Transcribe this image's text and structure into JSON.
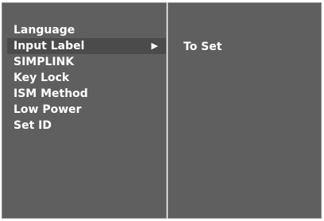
{
  "menu": {
    "items": [
      {
        "label": "Language"
      },
      {
        "label": "Input Label"
      },
      {
        "label": "SIMPLINK"
      },
      {
        "label": "Key Lock"
      },
      {
        "label": "ISM Method"
      },
      {
        "label": "Low Power"
      },
      {
        "label": "Set ID"
      }
    ],
    "selected_index": 1,
    "selected_arrow_icon": "triangle-right-icon"
  },
  "submenu": {
    "option_label": "To Set"
  },
  "colors": {
    "panel_background": "#5f5f5f",
    "selected_background": "#4b4b4b",
    "text": "#ffffff"
  }
}
